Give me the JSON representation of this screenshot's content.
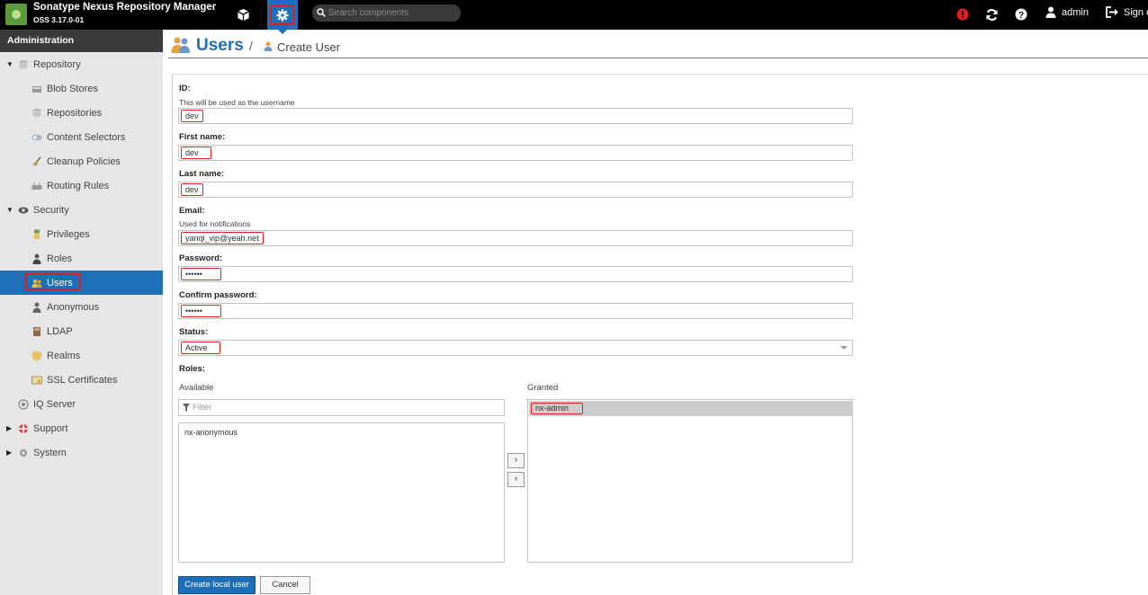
{
  "app": {
    "title": "Sonatype Nexus Repository Manager",
    "version": "OSS 3.17.0-01"
  },
  "topbar": {
    "search_placeholder": "Search components",
    "user_label": "admin",
    "signout_label": "Sign out",
    "colors": {
      "bar": "#000000",
      "active": "#1d6fba",
      "alert": "#e02020"
    }
  },
  "sidebar": {
    "header": "Administration",
    "items": [
      {
        "label": "Repository",
        "icon": "database-icon"
      },
      {
        "label": "Blob Stores",
        "icon": "server-icon"
      },
      {
        "label": "Repositories",
        "icon": "database-icon"
      },
      {
        "label": "Content Selectors",
        "icon": "selector-icon"
      },
      {
        "label": "Cleanup Policies",
        "icon": "broom-icon"
      },
      {
        "label": "Routing Rules",
        "icon": "router-icon"
      },
      {
        "label": "Security",
        "icon": "eye-icon"
      },
      {
        "label": "Privileges",
        "icon": "medal-icon"
      },
      {
        "label": "Roles",
        "icon": "user-tie-icon"
      },
      {
        "label": "Users",
        "icon": "users-icon"
      },
      {
        "label": "Anonymous",
        "icon": "user-icon"
      },
      {
        "label": "LDAP",
        "icon": "book-icon"
      },
      {
        "label": "Realms",
        "icon": "shield-icon"
      },
      {
        "label": "SSL Certificates",
        "icon": "certificate-icon"
      },
      {
        "label": "IQ Server",
        "icon": "iq-icon"
      },
      {
        "label": "Support",
        "icon": "lifebuoy-icon"
      },
      {
        "label": "System",
        "icon": "gear-icon"
      }
    ]
  },
  "page": {
    "title": "Users",
    "separator": "/",
    "subtitle": "Create User"
  },
  "form": {
    "id": {
      "label": "ID:",
      "help": "This will be used as the username",
      "value": "dev"
    },
    "first_name": {
      "label": "First name:",
      "value": "dev"
    },
    "last_name": {
      "label": "Last name:",
      "value": "dev"
    },
    "email": {
      "label": "Email:",
      "help": "Used for notifications",
      "value": "yanqi_vip@yeah.net"
    },
    "password": {
      "label": "Password:",
      "value": "••••••"
    },
    "confirm_password": {
      "label": "Confirm password:",
      "value": "••••••"
    },
    "status": {
      "label": "Status:",
      "value": "Active"
    },
    "roles": {
      "label": "Roles:",
      "available_label": "Available",
      "granted_label": "Granted",
      "filter_placeholder": "Filter",
      "available": [
        "nx-anonymous"
      ],
      "granted": [
        "nx-admin"
      ],
      "add_symbol": "›",
      "remove_symbol": "‹"
    },
    "create_button": "Create local user",
    "cancel_button": "Cancel"
  }
}
